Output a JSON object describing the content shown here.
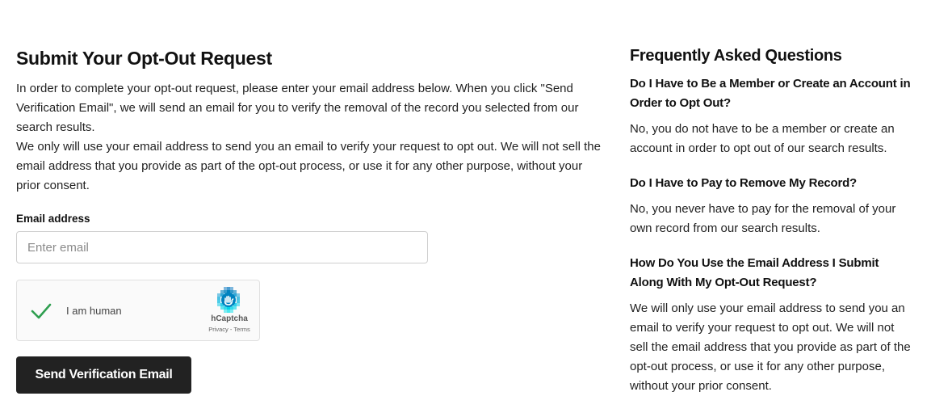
{
  "form": {
    "title": "Submit Your Opt-Out Request",
    "paragraph1": "In order to complete your opt-out request, please enter your email address below. When you click \"Send Verification Email\", we will send an email for you to verify the removal of the record you selected from our search results.",
    "paragraph2": "We only will use your email address to send you an email to verify your request to opt out. We will not sell the email address that you provide as part of the opt-out process, or use it for any other purpose, without your prior consent.",
    "email_label": "Email address",
    "email_placeholder": "Enter email",
    "email_value": "",
    "captcha": {
      "label": "I am human",
      "brand": "hCaptcha",
      "links": "Privacy - Terms",
      "checked": true,
      "check_color": "#2e9e4f"
    },
    "submit_label": "Send Verification Email"
  },
  "faq": {
    "title": "Frequently Asked Questions",
    "items": [
      {
        "question": "Do I Have to Be a Member or Create an Account in Order to Opt Out?",
        "answer": "No, you do not have to be a member or create an account in order to opt out of our search results."
      },
      {
        "question": "Do I Have to Pay to Remove My Record?",
        "answer": "No, you never have to pay for the removal of your own record from our search results."
      },
      {
        "question": "How Do You Use the Email Address I Submit Along With My Opt-Out Request?",
        "answer": "We will only use your email address to send you an email to verify your request to opt out. We will not sell the email address that you provide as part of the opt-out process, or use it for any other purpose, without your prior consent."
      }
    ]
  },
  "colors": {
    "button_bg": "#222222",
    "button_text": "#ffffff",
    "hcaptcha_brand": "#0074bf"
  },
  "icons": {
    "captcha_check": "checkmark-icon",
    "hcaptcha_logo": "hcaptcha-logo-icon"
  }
}
